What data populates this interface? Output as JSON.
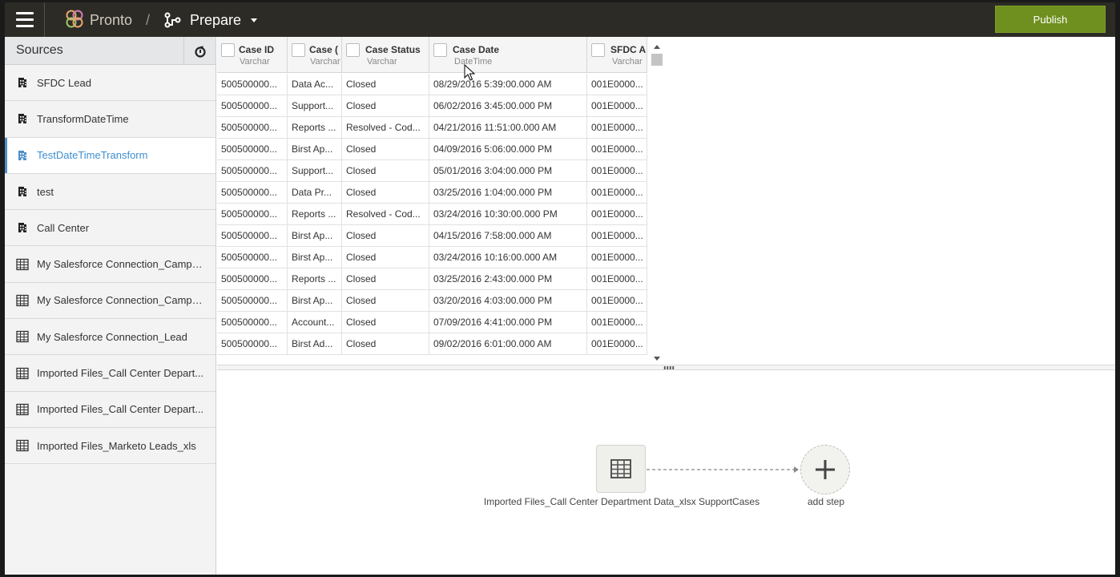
{
  "app": {
    "name": "Pronto",
    "separator": "/",
    "section": "Prepare",
    "publish_label": "Publish"
  },
  "sidebar": {
    "title": "Sources",
    "items": [
      {
        "label": "SFDC Lead",
        "icon": "building-icon",
        "active": false
      },
      {
        "label": "TransformDateTime",
        "icon": "building-icon",
        "active": false
      },
      {
        "label": "TestDateTimeTransform",
        "icon": "building-icon",
        "active": true
      },
      {
        "label": "test",
        "icon": "building-icon",
        "active": false
      },
      {
        "label": "Call Center",
        "icon": "building-icon",
        "active": false
      },
      {
        "label": "My Salesforce Connection_Campaign",
        "icon": "table-icon",
        "active": false
      },
      {
        "label": "My Salesforce Connection_Campai...",
        "icon": "table-icon",
        "active": false
      },
      {
        "label": "My Salesforce Connection_Lead",
        "icon": "table-icon",
        "active": false
      },
      {
        "label": "Imported Files_Call Center Depart...",
        "icon": "table-icon",
        "active": false
      },
      {
        "label": "Imported Files_Call Center Depart...",
        "icon": "table-icon",
        "active": false
      },
      {
        "label": "Imported Files_Marketo Leads_xls",
        "icon": "table-icon",
        "active": false
      }
    ]
  },
  "grid": {
    "columns": [
      {
        "name": "Case ID",
        "type": "Varchar"
      },
      {
        "name": "Case (",
        "type": "Varchar"
      },
      {
        "name": "Case Status",
        "type": "Varchar"
      },
      {
        "name": "Case Date",
        "type": "DateTime"
      },
      {
        "name": "SFDC A",
        "type": "Varchar"
      }
    ],
    "rows": [
      [
        "500500000...",
        "Data Ac...",
        "Closed",
        "08/29/2016 5:39:00.000 AM",
        "001E0000..."
      ],
      [
        "500500000...",
        "Support...",
        "Closed",
        "06/02/2016 3:45:00.000 PM",
        "001E0000..."
      ],
      [
        "500500000...",
        "Reports ...",
        "Resolved - Cod...",
        "04/21/2016 11:51:00.000 AM",
        "001E0000..."
      ],
      [
        "500500000...",
        "Birst Ap...",
        "Closed",
        "04/09/2016 5:06:00.000 PM",
        "001E0000..."
      ],
      [
        "500500000...",
        "Support...",
        "Closed",
        "05/01/2016 3:04:00.000 PM",
        "001E0000..."
      ],
      [
        "500500000...",
        "Data Pr...",
        "Closed",
        "03/25/2016 1:04:00.000 PM",
        "001E0000..."
      ],
      [
        "500500000...",
        "Reports ...",
        "Resolved - Cod...",
        "03/24/2016 10:30:00.000 PM",
        "001E0000..."
      ],
      [
        "500500000...",
        "Birst Ap...",
        "Closed",
        "04/15/2016 7:58:00.000 AM",
        "001E0000..."
      ],
      [
        "500500000...",
        "Birst Ap...",
        "Closed",
        "03/24/2016 10:16:00.000 AM",
        "001E0000..."
      ],
      [
        "500500000...",
        "Reports ...",
        "Closed",
        "03/25/2016 2:43:00.000 PM",
        "001E0000..."
      ],
      [
        "500500000...",
        "Birst Ap...",
        "Closed",
        "03/20/2016 4:03:00.000 PM",
        "001E0000..."
      ],
      [
        "500500000...",
        "Account...",
        "Closed",
        "07/09/2016 4:41:00.000 PM",
        "001E0000..."
      ],
      [
        "500500000...",
        "Birst Ad...",
        "Closed",
        "09/02/2016 6:01:00.000 AM",
        "001E0000..."
      ]
    ]
  },
  "flow": {
    "source_node_label": "Imported Files_Call Center Department Data_xlsx SupportCases",
    "add_step_label": "add step"
  },
  "colors": {
    "topbar": "#2d2b26",
    "publish": "#6f8f1f",
    "active_accent": "#4b8fca"
  }
}
